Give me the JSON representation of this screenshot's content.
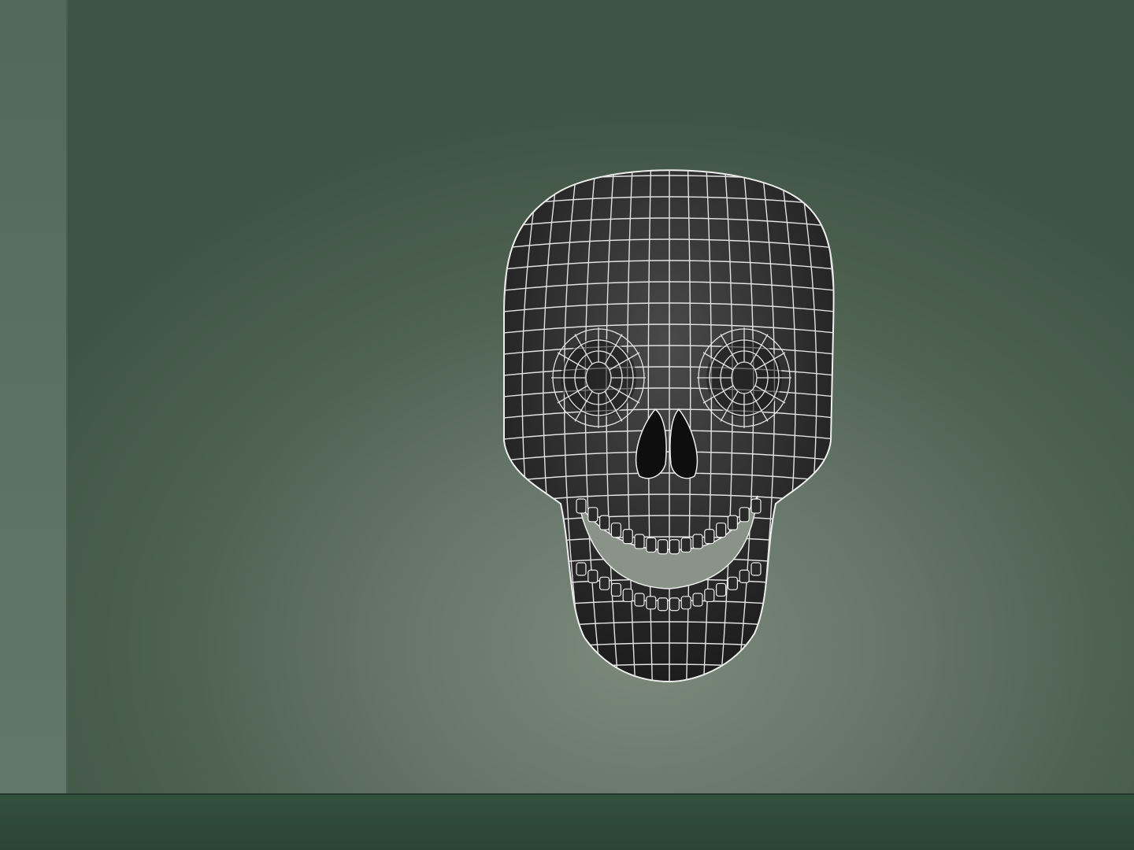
{
  "scene": {
    "subject": "skull",
    "colors": {
      "wall": "#5f7264",
      "floor": "#2e4836",
      "mesh_fill": "#2b2b2b",
      "wireframe": "#e6e6e6"
    }
  }
}
